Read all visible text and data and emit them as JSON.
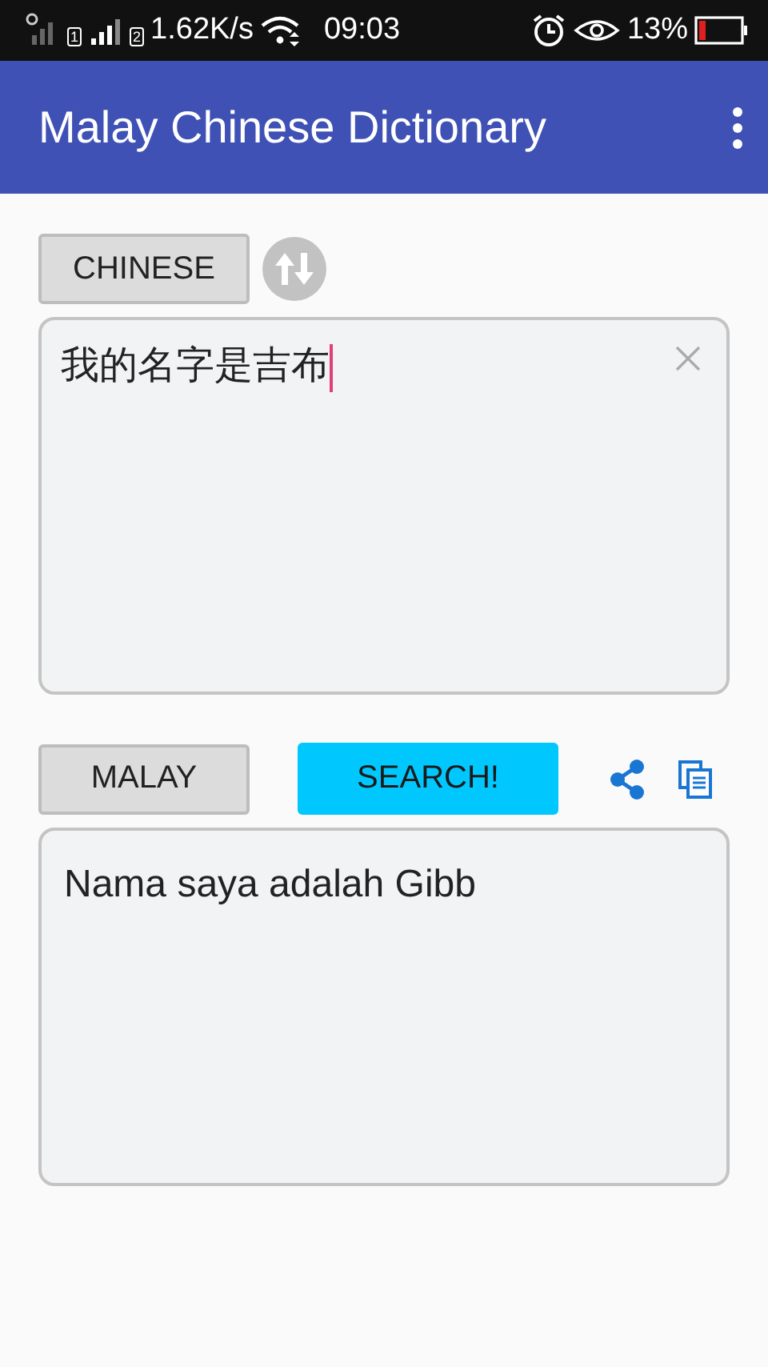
{
  "status_bar": {
    "sim_slots": [
      "1",
      "2"
    ],
    "speed": "1.62K/s",
    "time": "09:03",
    "battery": "13%"
  },
  "app_bar": {
    "title": "Malay Chinese Dictionary"
  },
  "source": {
    "language": "CHINESE",
    "value": "我的名字是吉布"
  },
  "target": {
    "language": "MALAY",
    "search": "SEARCH!",
    "value": "Nama saya adalah Gibb"
  }
}
